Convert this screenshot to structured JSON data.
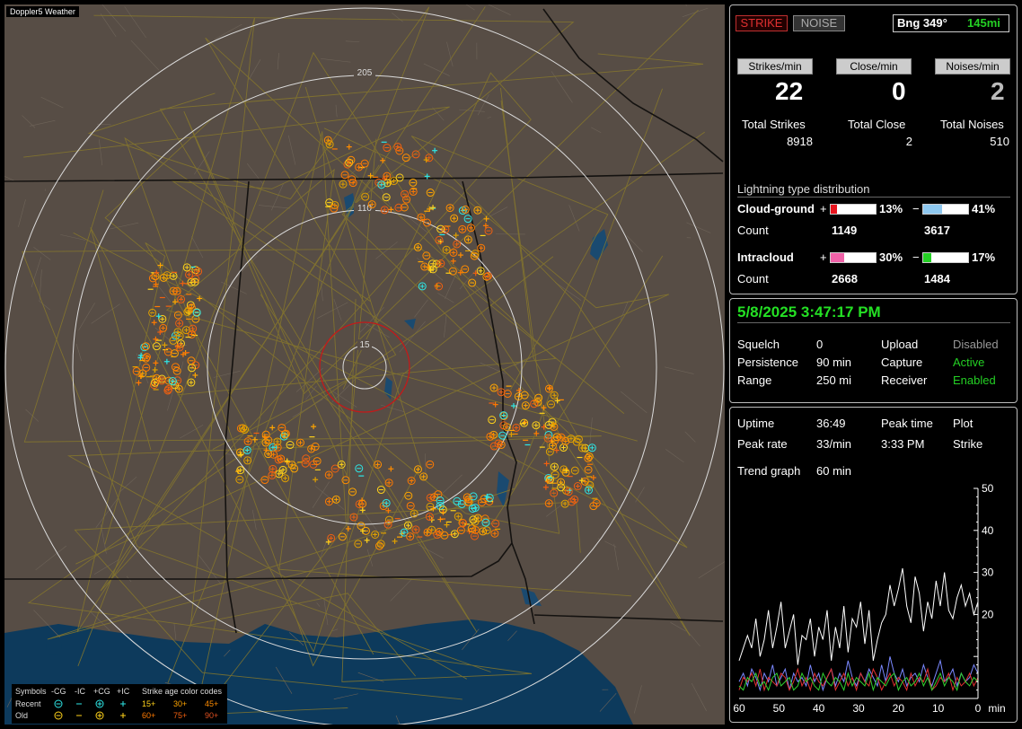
{
  "app_title": "Doppler5 Weather",
  "map": {
    "ring_labels": [
      "205",
      "110",
      "15"
    ],
    "colors": {
      "land": "#574d45",
      "water": "#0d3a5c",
      "county": "#6e6459",
      "state": "#141210",
      "road": "#8a7a2a",
      "ring": "#dcdcdc",
      "close_ring": "#c21a1a"
    }
  },
  "legend": {
    "symbols_label": "Symbols",
    "cols": [
      "-CG",
      "-IC",
      "+CG",
      "+IC"
    ],
    "recent_label": "Recent",
    "old_label": "Old",
    "age_title": "Strike age color codes",
    "ages_recent": [
      "15+",
      "30+",
      "45+"
    ],
    "ages_old": [
      "60+",
      "75+",
      "90+"
    ]
  },
  "top": {
    "strike_label": "STRIKE",
    "noise_label": "NOISE",
    "bearing": "Bng 349°",
    "distance": "145mi"
  },
  "rates": {
    "strikes_label": "Strikes/min",
    "close_label": "Close/min",
    "noises_label": "Noises/min",
    "strikes_value": "22",
    "close_value": "0",
    "noises_value": "2"
  },
  "totals": {
    "strikes_label": "Total Strikes",
    "close_label": "Total Close",
    "noises_label": "Total Noises",
    "strikes_value": "8918",
    "close_value": "2",
    "noises_value": "510"
  },
  "distribution": {
    "title": "Lightning type distribution",
    "cg_label": "Cloud-ground",
    "ic_label": "Intracloud",
    "count_label": "Count",
    "plus": "+",
    "minus": "−",
    "cg_pos_pct": "13%",
    "cg_neg_pct": "41%",
    "ic_pos_pct": "30%",
    "ic_neg_pct": "17%",
    "cg_pos_fraction": 0.13,
    "cg_neg_fraction": 0.41,
    "ic_pos_fraction": 0.3,
    "ic_neg_fraction": 0.17,
    "cg_pos_count": "1149",
    "cg_neg_count": "3617",
    "ic_pos_count": "2668",
    "ic_neg_count": "1484",
    "colors": {
      "cg_pos": "#e8141e",
      "cg_neg": "#8ec8f0",
      "ic_pos": "#f062a8",
      "ic_neg": "#24d024"
    }
  },
  "status": {
    "datetime": "5/8/2025 3:47:17 PM",
    "squelch_label": "Squelch",
    "squelch_value": "0",
    "persistence_label": "Persistence",
    "persistence_value": "90 min",
    "range_label": "Range",
    "range_value": "250 mi",
    "upload_label": "Upload",
    "upload_value": "Disabled",
    "capture_label": "Capture",
    "capture_value": "Active",
    "receiver_label": "Receiver",
    "receiver_value": "Enabled"
  },
  "stats": {
    "uptime_label": "Uptime",
    "uptime_value": "36:49",
    "peak_time_label": "Peak time",
    "peak_time_value": "3:33 PM",
    "plot_label": "Plot",
    "peak_rate_label": "Peak rate",
    "peak_rate_value": "33/min",
    "plot_value": "Strike",
    "trend_label": "Trend graph",
    "trend_value": "60 min"
  },
  "chart_data": {
    "type": "line",
    "x_ticks": [
      "60",
      "50",
      "40",
      "30",
      "20",
      "10",
      "0"
    ],
    "x_unit": "min",
    "y_ticks": [
      "50",
      "40",
      "30",
      "20"
    ],
    "ylim": [
      0,
      50
    ],
    "xlim": [
      60,
      0
    ],
    "series": [
      {
        "color": "#ffffff",
        "values": [
          9,
          12,
          15,
          12,
          19,
          10,
          14,
          21,
          12,
          17,
          23,
          12,
          16,
          20,
          8,
          15,
          14,
          19,
          10,
          17,
          14,
          21,
          9,
          17,
          12,
          22,
          11,
          19,
          17,
          23,
          13,
          21,
          9,
          14,
          18,
          20,
          27,
          22,
          26,
          31,
          22,
          18,
          29,
          25,
          16,
          23,
          19,
          28,
          22,
          30,
          21,
          19,
          24,
          27,
          22,
          25,
          20,
          23
        ]
      },
      {
        "color": "#7a88ff",
        "values": [
          4,
          6,
          3,
          7,
          5,
          2,
          6,
          4,
          8,
          3,
          5,
          7,
          2,
          6,
          4,
          5,
          3,
          8,
          4,
          6,
          2,
          5,
          7,
          3,
          6,
          4,
          9,
          5,
          3,
          6,
          4,
          7,
          5,
          3,
          8,
          4,
          10,
          6,
          4,
          7,
          3,
          5,
          6,
          4,
          8,
          5,
          3,
          6,
          9,
          4,
          5,
          7,
          3,
          6,
          4,
          5,
          8,
          6
        ]
      },
      {
        "color": "#e03030",
        "values": [
          2,
          5,
          4,
          6,
          3,
          7,
          2,
          5,
          4,
          3,
          6,
          5,
          2,
          4,
          7,
          3,
          5,
          2,
          6,
          4,
          3,
          5,
          7,
          2,
          4,
          6,
          3,
          5,
          2,
          6,
          4,
          3,
          7,
          5,
          2,
          4,
          6,
          3,
          5,
          4,
          2,
          6,
          3,
          5,
          4,
          7,
          2,
          3,
          5,
          4,
          6,
          2,
          5,
          3,
          4,
          6,
          3,
          5
        ]
      },
      {
        "color": "#30d030",
        "values": [
          3,
          2,
          5,
          4,
          6,
          3,
          4,
          2,
          5,
          6,
          3,
          4,
          5,
          2,
          3,
          6,
          4,
          5,
          3,
          2,
          6,
          4,
          3,
          5,
          4,
          2,
          6,
          3,
          5,
          4,
          3,
          6,
          2,
          5,
          4,
          3,
          5,
          6,
          2,
          4,
          5,
          3,
          4,
          6,
          3,
          5,
          2,
          4,
          6,
          3,
          5,
          4,
          2,
          6,
          4,
          3,
          5,
          4
        ]
      }
    ]
  }
}
